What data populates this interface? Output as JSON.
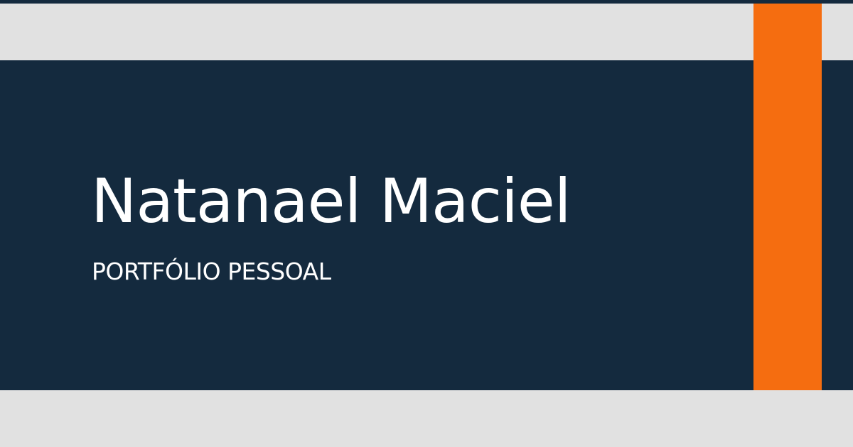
{
  "card": {
    "title": "Natanael Maciel",
    "subtitle": "PORTFÓLIO PESSOAL"
  },
  "colors": {
    "dark_navy": "#142a3e",
    "light_gray": "#e1e1e1",
    "accent_orange": "#f56d10",
    "text": "#ffffff"
  }
}
